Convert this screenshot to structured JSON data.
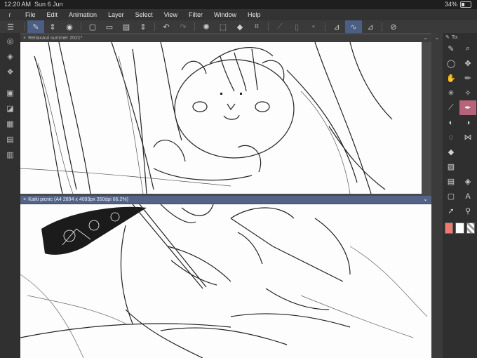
{
  "status": {
    "time": "12:20 AM",
    "date": "Sun 6 Jun",
    "battery": "34%",
    "battery_level": 0.34
  },
  "menu": [
    "File",
    "Edit",
    "Animation",
    "Layer",
    "Select",
    "View",
    "Filter",
    "Window",
    "Help"
  ],
  "documents": [
    {
      "title": "ReitaxAoi summer 2021*"
    },
    {
      "title": "Kaiki picnic (A4 2894 x 4093px 350dpi 66.2%)"
    }
  ],
  "right_panel": {
    "title": "To:"
  },
  "icons": {
    "app_logo": "clip-studio-logo",
    "toolbar": [
      "menu-icon",
      "pen-tool-icon",
      "stepper-icon",
      "fill-icon",
      "new-icon",
      "open-icon",
      "save-icon",
      "stepper-icon",
      "undo-icon",
      "redo-icon",
      "loading-icon",
      "transform-icon",
      "fill-bucket-icon",
      "crop-icon",
      "ruler-icon",
      "rectangle-icon",
      "square-icon",
      "line-icon",
      "smooth-line-icon",
      "curve-icon",
      "share-icon"
    ],
    "left_bar": [
      "navigator-icon",
      "layers-icon",
      "layer-stack-icon",
      "camera-icon",
      "materials-icon",
      "grid-icon",
      "timeline-icon",
      "calculator-icon"
    ],
    "tools": [
      "pen-icon",
      "search-icon",
      "lasso-icon",
      "move-icon",
      "hand-icon",
      "pencil-icon",
      "magic-wand-icon",
      "sparkle-icon",
      "eyedropper-icon",
      "brush-icon",
      "fill-icon",
      "blend-icon",
      "lasso-select-icon",
      "fx-icon",
      "eraser-icon",
      "blank-icon",
      "gradient-icon",
      "blank-icon",
      "frame-icon",
      "fill-bucket-icon",
      "square-icon",
      "text-icon",
      "arrow-icon",
      "lock-icon"
    ]
  },
  "colors": {
    "accent": "#4a5f83",
    "main_color": "#f07870",
    "sub_color": "#ffffff",
    "selected_tool": "#b5647a"
  }
}
